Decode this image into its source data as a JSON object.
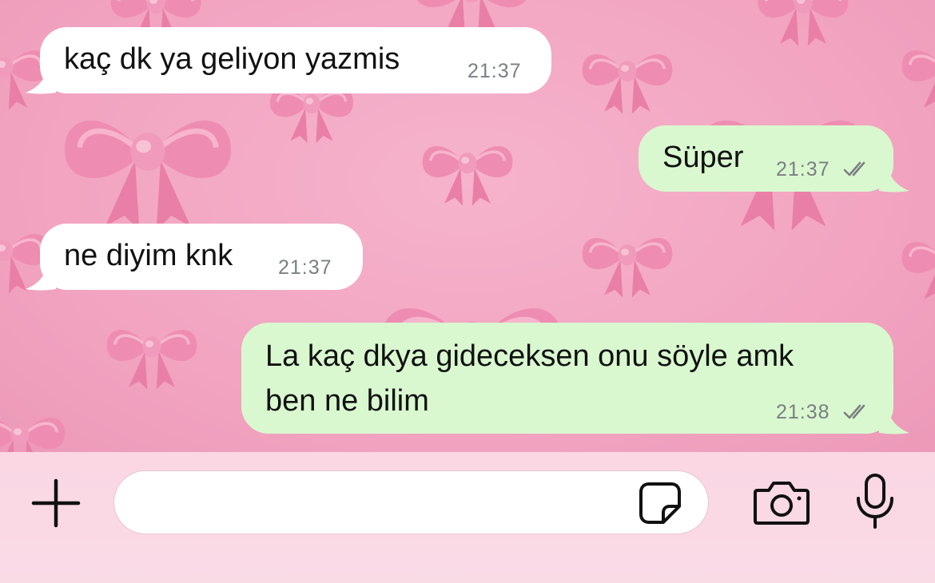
{
  "messages": [
    {
      "direction": "incoming",
      "text": "kaç dk ya geliyon yazmis",
      "time": "21:37"
    },
    {
      "direction": "outgoing",
      "text": "Süper",
      "time": "21:37",
      "status": "read"
    },
    {
      "direction": "incoming",
      "text": "ne diyim knk",
      "time": "21:37"
    },
    {
      "direction": "outgoing",
      "text_lines": [
        "La kaç dkya gideceksen onu söyle amk",
        "ben ne bilim"
      ],
      "time": "21:38",
      "status": "read"
    }
  ],
  "composer": {
    "placeholder": "",
    "value": ""
  },
  "icons": {
    "attach": "plus-icon",
    "sticker": "sticker-icon",
    "camera": "camera-icon",
    "microphone": "microphone-icon",
    "read_receipt": "double-check-icon"
  },
  "colors": {
    "incoming_bubble": "#ffffff",
    "outgoing_bubble": "#d9f8cf",
    "wallpaper": "#f3a7c3",
    "timestamp": "#7b7f84",
    "input_bar": "#fbd6e3"
  }
}
